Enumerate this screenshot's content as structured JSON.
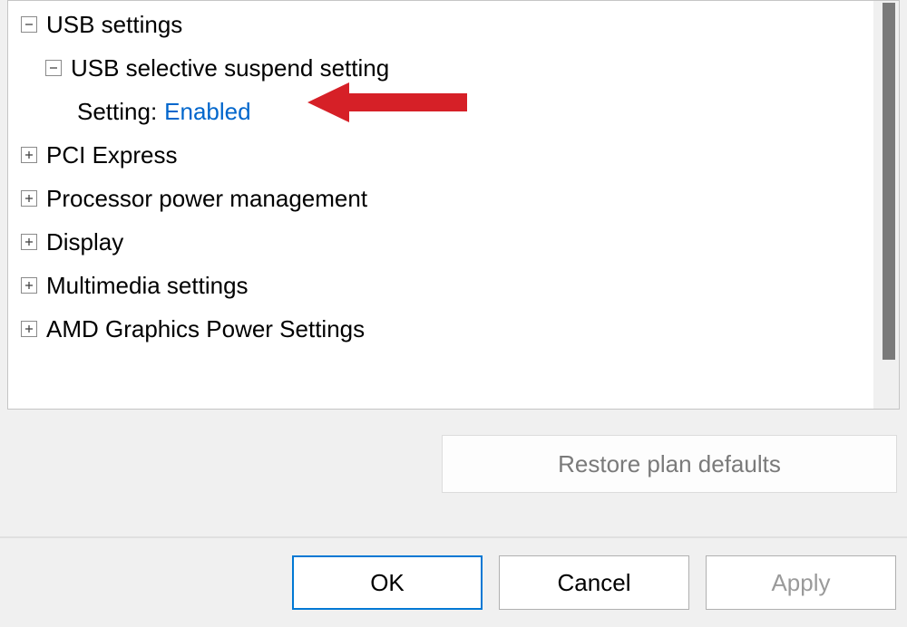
{
  "tree": {
    "usb_settings": "USB settings",
    "usb_selective_suspend": "USB selective suspend setting",
    "setting_label": "Setting:",
    "setting_value": "Enabled",
    "pci_express": "PCI Express",
    "processor_power": "Processor power management",
    "display": "Display",
    "multimedia": "Multimedia settings",
    "amd_graphics": "AMD Graphics Power Settings"
  },
  "buttons": {
    "restore_defaults": "Restore plan defaults",
    "ok": "OK",
    "cancel": "Cancel",
    "apply": "Apply"
  },
  "colors": {
    "link": "#0066cc",
    "arrow": "#d62027"
  }
}
